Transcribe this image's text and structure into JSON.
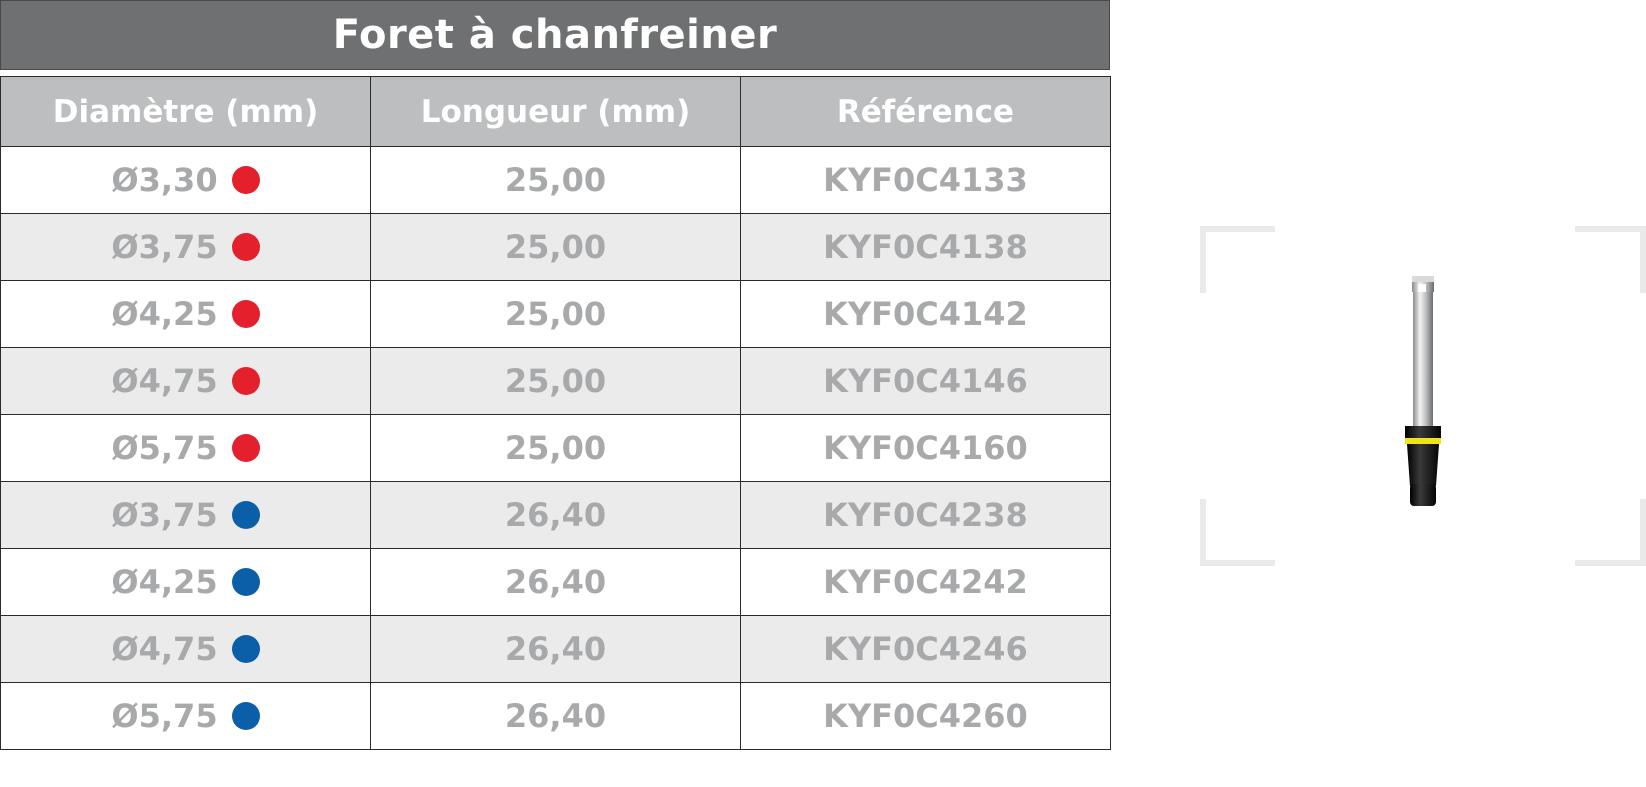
{
  "title": "Foret à chanfreiner",
  "headers": [
    "Diamètre (mm)",
    "Longueur (mm)",
    "Référence"
  ],
  "colors": {
    "red": "#e3202b",
    "blue": "#0a5fa8"
  },
  "rows": [
    {
      "diameter": "Ø3,30",
      "dot": "red",
      "length": "25,00",
      "ref": "KYF0C4133"
    },
    {
      "diameter": "Ø3,75",
      "dot": "red",
      "length": "25,00",
      "ref": "KYF0C4138"
    },
    {
      "diameter": "Ø4,25",
      "dot": "red",
      "length": "25,00",
      "ref": "KYF0C4142"
    },
    {
      "diameter": "Ø4,75",
      "dot": "red",
      "length": "25,00",
      "ref": "KYF0C4146"
    },
    {
      "diameter": "Ø5,75",
      "dot": "red",
      "length": "25,00",
      "ref": "KYF0C4160"
    },
    {
      "diameter": "Ø3,75",
      "dot": "blue",
      "length": "26,40",
      "ref": "KYF0C4238"
    },
    {
      "diameter": "Ø4,25",
      "dot": "blue",
      "length": "26,40",
      "ref": "KYF0C4242"
    },
    {
      "diameter": "Ø4,75",
      "dot": "blue",
      "length": "26,40",
      "ref": "KYF0C4246"
    },
    {
      "diameter": "Ø5,75",
      "dot": "blue",
      "length": "26,40",
      "ref": "KYF0C4260"
    }
  ],
  "product_image": {
    "icon": "chamfer-drill-icon"
  }
}
